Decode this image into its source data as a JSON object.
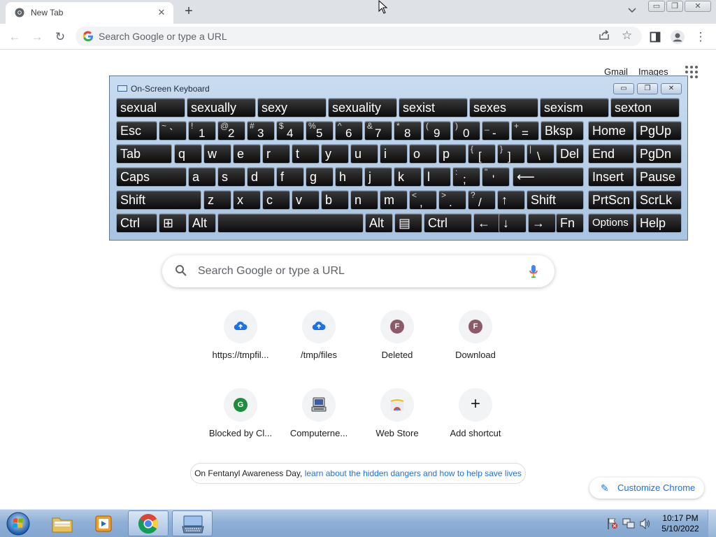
{
  "browser": {
    "tab_title": "New Tab",
    "omnibox_placeholder": "Search Google or type a URL"
  },
  "ntp": {
    "top_links": [
      "Gmail",
      "Images"
    ],
    "search_placeholder": "Search Google or type a URL",
    "shortcuts": [
      {
        "label": "https://tmpfil...",
        "icon": "cloud-upload-icon"
      },
      {
        "label": "/tmp/files",
        "icon": "cloud-upload-icon"
      },
      {
        "label": "Deleted",
        "icon": "letter-avatar",
        "letter": "F",
        "color": "#8e5a6a"
      },
      {
        "label": "Download",
        "icon": "letter-avatar",
        "letter": "F",
        "color": "#8e5a6a"
      },
      {
        "label": "Blocked by Cl...",
        "icon": "letter-avatar",
        "letter": "G",
        "color": "#1e8e3e"
      },
      {
        "label": "Computerne...",
        "icon": "computer-icon"
      },
      {
        "label": "Web Store",
        "icon": "web-store-icon"
      },
      {
        "label": "Add shortcut",
        "icon": "plus-icon"
      }
    ],
    "promo_prefix": "On Fentanyl Awareness Day, ",
    "promo_link": "learn about the hidden dangers and how to help save lives",
    "customize_label": "Customize Chrome"
  },
  "osk": {
    "title": "On-Screen Keyboard",
    "suggestions": [
      "sexual",
      "sexually",
      "sexy",
      "sexuality",
      "sexist",
      "sexes",
      "sexism",
      "sexton"
    ],
    "rows": [
      [
        {
          "main": "Esc"
        },
        {
          "shift": "~",
          "main": "`"
        },
        {
          "shift": "!",
          "main": "1"
        },
        {
          "shift": "@",
          "main": "2"
        },
        {
          "shift": "#",
          "main": "3"
        },
        {
          "shift": "$",
          "main": "4"
        },
        {
          "shift": "%",
          "main": "5"
        },
        {
          "shift": "^",
          "main": "6"
        },
        {
          "shift": "&",
          "main": "7"
        },
        {
          "shift": "*",
          "main": "8"
        },
        {
          "shift": "(",
          "main": "9"
        },
        {
          "shift": ")",
          "main": "0"
        },
        {
          "shift": "_",
          "main": "-"
        },
        {
          "shift": "+",
          "main": "="
        },
        {
          "main": "Bksp"
        },
        {
          "main": "Home"
        },
        {
          "main": "PgUp"
        }
      ],
      [
        {
          "main": "Tab"
        },
        {
          "main": "q"
        },
        {
          "main": "w"
        },
        {
          "main": "e"
        },
        {
          "main": "r"
        },
        {
          "main": "t"
        },
        {
          "main": "y"
        },
        {
          "main": "u"
        },
        {
          "main": "i"
        },
        {
          "main": "o"
        },
        {
          "main": "p"
        },
        {
          "shift": "{",
          "main": "["
        },
        {
          "shift": "}",
          "main": "]"
        },
        {
          "shift": "|",
          "main": "\\"
        },
        {
          "main": "Del"
        },
        {
          "main": "End"
        },
        {
          "main": "PgDn"
        }
      ],
      [
        {
          "main": "Caps"
        },
        {
          "main": "a"
        },
        {
          "main": "s"
        },
        {
          "main": "d"
        },
        {
          "main": "f"
        },
        {
          "main": "g"
        },
        {
          "main": "h"
        },
        {
          "main": "j"
        },
        {
          "main": "k"
        },
        {
          "main": "l"
        },
        {
          "shift": ":",
          "main": ";"
        },
        {
          "shift": "\"",
          "main": "'"
        },
        {
          "main": "⟵"
        },
        {
          "main": "Insert"
        },
        {
          "main": "Pause"
        }
      ],
      [
        {
          "main": "Shift"
        },
        {
          "main": "z"
        },
        {
          "main": "x"
        },
        {
          "main": "c"
        },
        {
          "main": "v"
        },
        {
          "main": "b"
        },
        {
          "main": "n"
        },
        {
          "main": "m"
        },
        {
          "shift": "<",
          "main": ","
        },
        {
          "shift": ">",
          "main": "."
        },
        {
          "shift": "?",
          "main": "/"
        },
        {
          "main": "↑"
        },
        {
          "main": "Shift"
        },
        {
          "main": "PrtScn"
        },
        {
          "main": "ScrLk"
        }
      ],
      [
        {
          "main": "Ctrl"
        },
        {
          "main": "⊞"
        },
        {
          "main": "Alt"
        },
        {
          "main": ""
        },
        {
          "main": "Alt"
        },
        {
          "main": "▤"
        },
        {
          "main": "Ctrl"
        },
        {
          "main": "←"
        },
        {
          "main": "↓"
        },
        {
          "main": "→"
        },
        {
          "main": "Fn"
        },
        {
          "main": "Options"
        },
        {
          "main": "Help"
        }
      ]
    ]
  },
  "taskbar": {
    "time": "10:17 PM",
    "date": "5/10/2022"
  }
}
